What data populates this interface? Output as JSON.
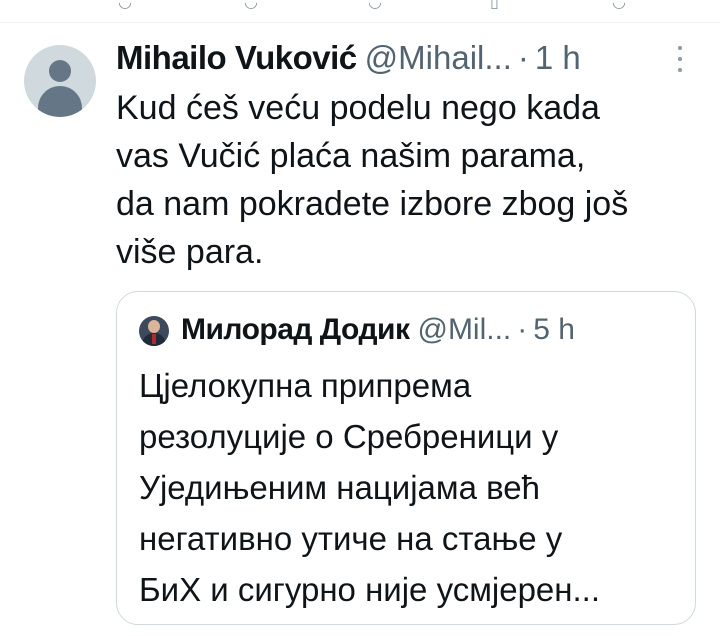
{
  "tweet": {
    "author_name": "Mihailo Vuković",
    "handle": "@Mihail...",
    "separator": "·",
    "time": "1 h",
    "text_lines": [
      "Kud ćeš veću podelu nego kada",
      "vas Vučić plaća našim parama,",
      "da nam pokradete izbore zbog još",
      "više para."
    ]
  },
  "quoted_tweet": {
    "author_name": "Милорад Додик",
    "handle": "@Mil...",
    "separator": "·",
    "time": "5 h",
    "text_lines": [
      "Цјелокупна припрема",
      "резолуције о Сребреници у",
      "Уједињеним нацијама већ",
      "негативно утиче на стање у",
      "БиХ и сигурно није усмјерен..."
    ]
  },
  "icons": {
    "avatar": "default-profile-icon",
    "more": "more-vertical-icon",
    "quoted_avatar": "profile-photo-icon"
  },
  "colors": {
    "text": "#0f1419",
    "muted": "#536471",
    "border": "#cfd9de",
    "avatar_bg": "#cfd9de"
  }
}
